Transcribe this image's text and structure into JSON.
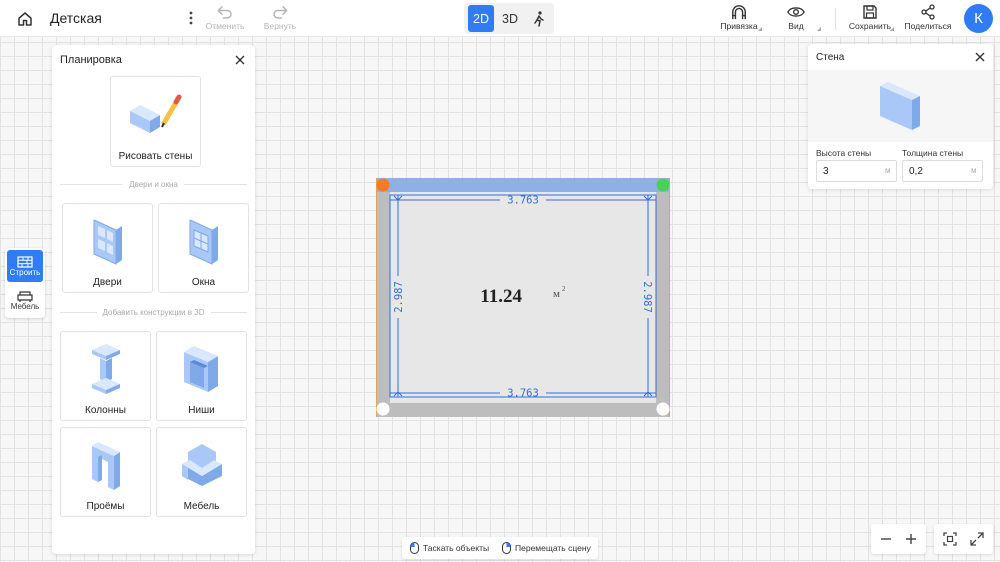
{
  "header": {
    "project_title": "Детская",
    "undo_label": "Отменить",
    "redo_label": "Вернуть",
    "view_2d": "2D",
    "view_3d": "3D",
    "snap_label": "Привязка",
    "view_label": "Вид",
    "save_label": "Сохранить",
    "share_label": "Поделиться",
    "avatar_letter": "К",
    "accent_color": "#2f7cf6"
  },
  "left_rail": {
    "build_label": "Строить",
    "furniture_label": "Мебель"
  },
  "planning_panel": {
    "title": "Планировка",
    "draw_walls_label": "Рисовать стены",
    "doors_windows_section": "Двери и окна",
    "doors_label": "Двери",
    "windows_label": "Окна",
    "constructions_section": "Добавить конструкции в 3D",
    "columns_label": "Колонны",
    "niches_label": "Ниши",
    "openings_label": "Проёмы",
    "furniture_label": "Мебель"
  },
  "wall_panel": {
    "title": "Стена",
    "height_label": "Высота стены",
    "height_value": "3",
    "height_unit": "м",
    "thickness_label": "Толщина стены",
    "thickness_value": "0,2",
    "thickness_unit": "м"
  },
  "room": {
    "area_value": "11.24",
    "area_unit": "м",
    "area_unit_sup": "2",
    "top_dim": "3.763",
    "bottom_dim": "3.763",
    "left_dim": "2.987",
    "right_dim": "2.987",
    "start_node_color": "#f57c1f",
    "end_node_color": "#4cd158"
  },
  "bottom_hints": {
    "drag_objects": "Таскать объекты",
    "move_scene": "Перемещать сцену"
  }
}
